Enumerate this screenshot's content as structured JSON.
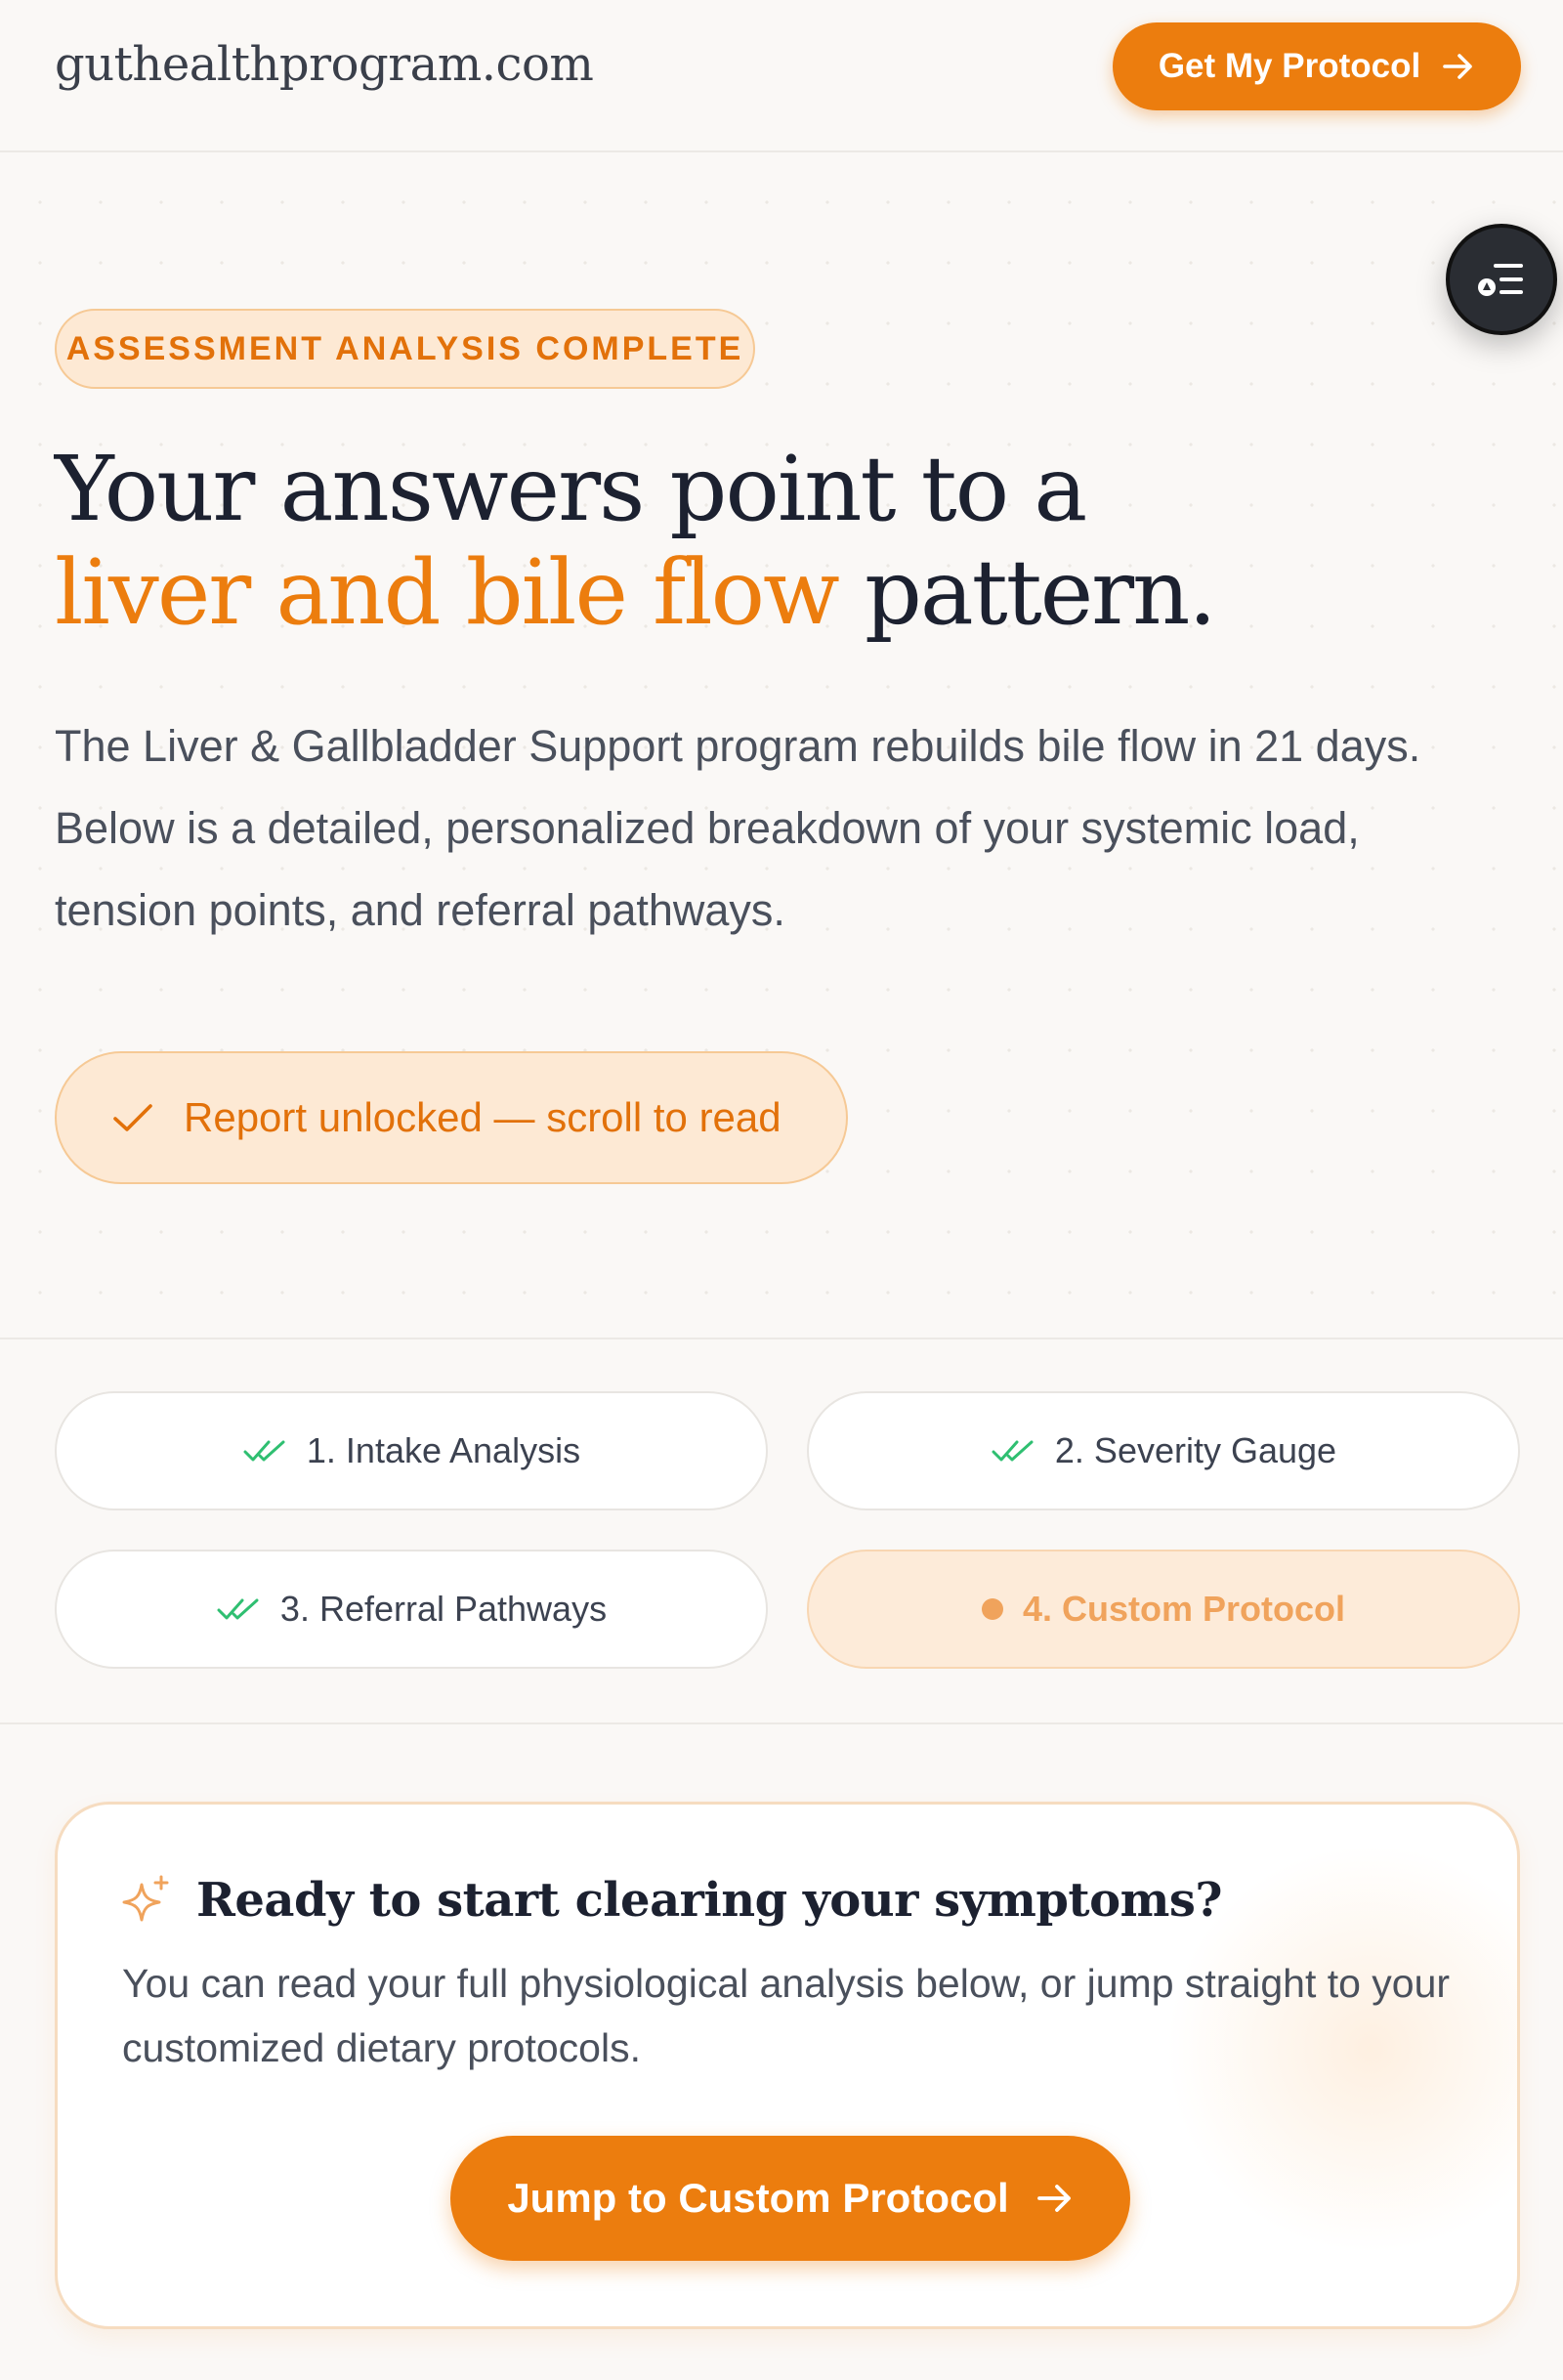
{
  "header": {
    "site_name": "guthealthprogram.com",
    "cta_label": "Get My Protocol"
  },
  "hero": {
    "badge": "ASSESSMENT ANALYSIS COMPLETE",
    "title_line1": "Your answers point to a",
    "title_accent": "liver and bile flow",
    "title_tail": " pattern.",
    "subtitle": "The Liver & Gallbladder Support program rebuilds bile flow in 21 days. Below is a detailed, personalized breakdown of your systemic load, tension points, and referral pathways.",
    "unlock_label": "Report unlocked — scroll to read"
  },
  "steps": [
    {
      "label": "1. Intake Analysis",
      "status": "complete"
    },
    {
      "label": "2. Severity Gauge",
      "status": "complete"
    },
    {
      "label": "3. Referral Pathways",
      "status": "complete"
    },
    {
      "label": "4. Custom Protocol",
      "status": "active"
    }
  ],
  "card": {
    "title": "Ready to start clearing your symptoms?",
    "body": "You can read your full physiological analysis below, or jump straight to your customized dietary protocols.",
    "cta_label": "Jump to Custom Protocol"
  },
  "colors": {
    "accent": "#ec7d0e",
    "accent_soft": "#fde9d4",
    "check_green": "#2fbf71",
    "text_dark": "#1c2130"
  },
  "icons": {
    "header_cta": "arrow-right-icon",
    "fab": "menu-list-icon",
    "unlock": "check-icon",
    "steps_complete": "double-check-icon",
    "steps_active": "dot-icon",
    "card_title": "sparkle-icon",
    "card_cta": "arrow-right-icon"
  }
}
